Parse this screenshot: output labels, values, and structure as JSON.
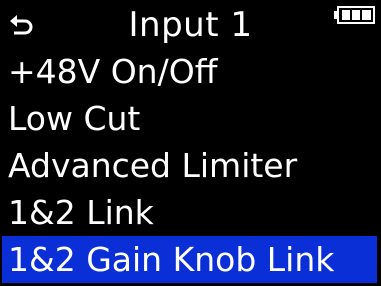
{
  "header": {
    "title": "Input 1",
    "back_icon": "return-arrow-icon",
    "battery_icon": "battery-full-icon"
  },
  "menu": {
    "items": [
      {
        "label": "+48V On/Off",
        "selected": false
      },
      {
        "label": "Low Cut",
        "selected": false
      },
      {
        "label": "Advanced Limiter",
        "selected": false
      },
      {
        "label": "1&2 Link",
        "selected": false
      },
      {
        "label": "1&2 Gain Knob Link",
        "selected": true
      }
    ]
  },
  "colors": {
    "background": "#000000",
    "text": "#ffffff",
    "selection": "#0a2fd6"
  }
}
